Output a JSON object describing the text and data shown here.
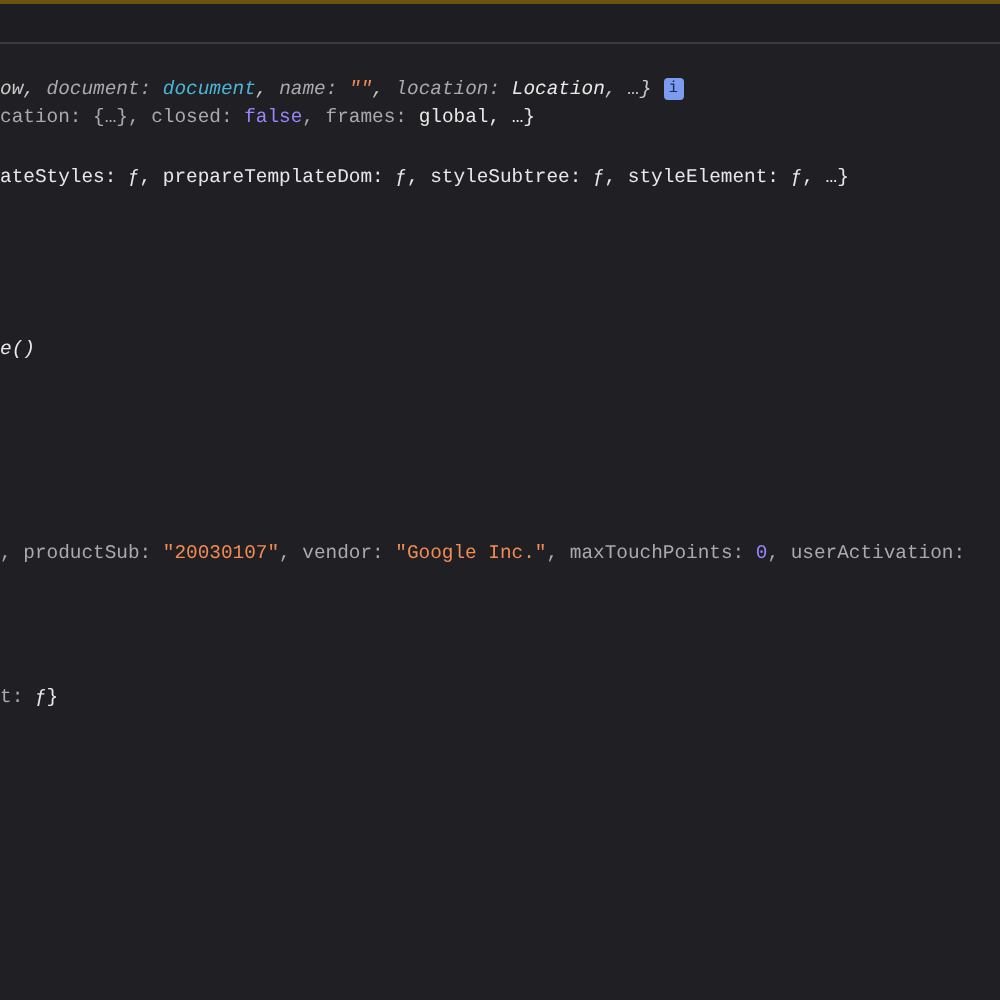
{
  "console_lines": [
    {
      "italic": true,
      "info_badge": "i",
      "tokens": [
        {
          "text": "ow, ",
          "kind": "punct"
        },
        {
          "text": "document: ",
          "kind": "key"
        },
        {
          "text": "document",
          "kind": "object"
        },
        {
          "text": ", ",
          "kind": "punct"
        },
        {
          "text": "name: ",
          "kind": "key"
        },
        {
          "text": "\"\"",
          "kind": "string"
        },
        {
          "text": ", ",
          "kind": "punct"
        },
        {
          "text": "location: ",
          "kind": "key"
        },
        {
          "text": "Location",
          "kind": "value"
        },
        {
          "text": ", …}",
          "kind": "punct"
        }
      ]
    },
    {
      "italic": false,
      "tokens": [
        {
          "text": "cation: {…}, closed: ",
          "kind": "key"
        },
        {
          "text": "false",
          "kind": "keyword"
        },
        {
          "text": ", frames: ",
          "kind": "key"
        },
        {
          "text": "global, …}",
          "kind": "value"
        }
      ]
    },
    {
      "italic": false,
      "tokens": [
        {
          "text": "ateStyles: ƒ, prepareTemplateDom: ƒ, styleSubtree: ƒ, styleElement: ƒ, …}",
          "kind": "value"
        }
      ]
    },
    {
      "italic": true,
      "tokens": [
        {
          "text": "e()",
          "kind": "value"
        }
      ]
    },
    {
      "italic": false,
      "tokens": [
        {
          "text": ", productSub: ",
          "kind": "key"
        },
        {
          "text": "\"20030107\"",
          "kind": "string"
        },
        {
          "text": ", vendor: ",
          "kind": "key"
        },
        {
          "text": "\"Google Inc.\"",
          "kind": "string"
        },
        {
          "text": ", maxTouchPoints: ",
          "kind": "key"
        },
        {
          "text": "0",
          "kind": "keyword"
        },
        {
          "text": ", userActivation:",
          "kind": "key"
        }
      ]
    },
    {
      "italic": false,
      "tokens": [
        {
          "text": "t: ",
          "kind": "key"
        },
        {
          "text": "ƒ}",
          "kind": "value"
        }
      ]
    }
  ]
}
